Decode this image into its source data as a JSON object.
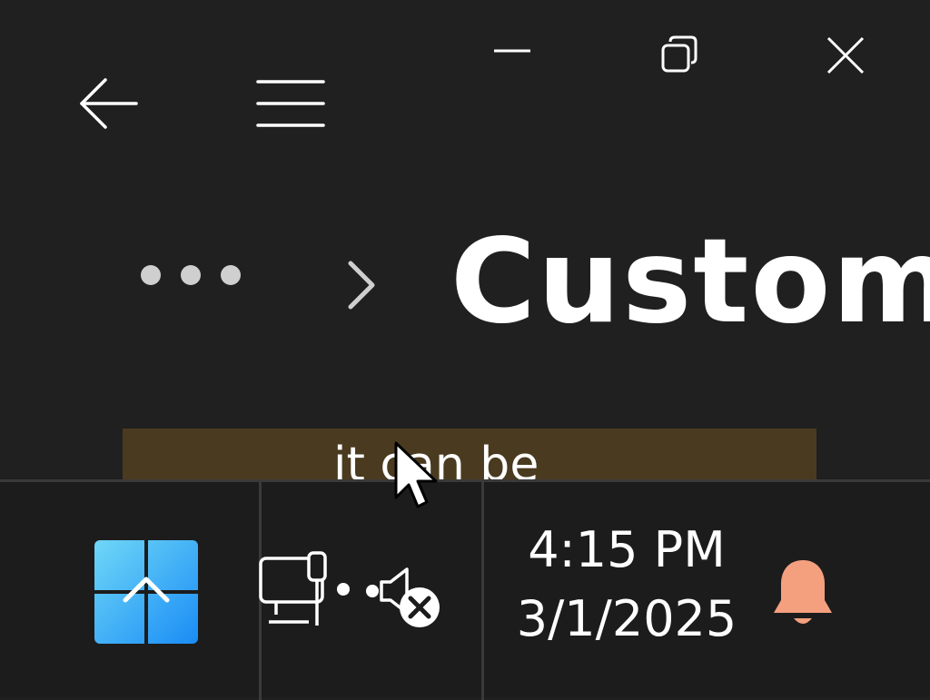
{
  "window": {
    "buttons": [
      "minimize",
      "restore",
      "close"
    ]
  },
  "nav": {
    "back_icon": "back-arrow-icon",
    "menu_icon": "hamburger-menu-icon"
  },
  "breadcrumb": {
    "overflow_icon": "ellipsis-icon",
    "separator_icon": "chevron-right-icon",
    "current": "Custom"
  },
  "banner": {
    "text": "it can be",
    "color": "#4a3a1f"
  },
  "taskbar": {
    "start_icon": "start-button-icon",
    "network_icon": "wired-network-icon",
    "volume_icon": "volume-muted-icon",
    "time": "4:15 PM",
    "date": "3/1/2025",
    "notification_icon": "bell-icon",
    "notification_color": "#f4a07f",
    "start_gradient": [
      "#6fd7f7",
      "#1a8cf5"
    ]
  }
}
